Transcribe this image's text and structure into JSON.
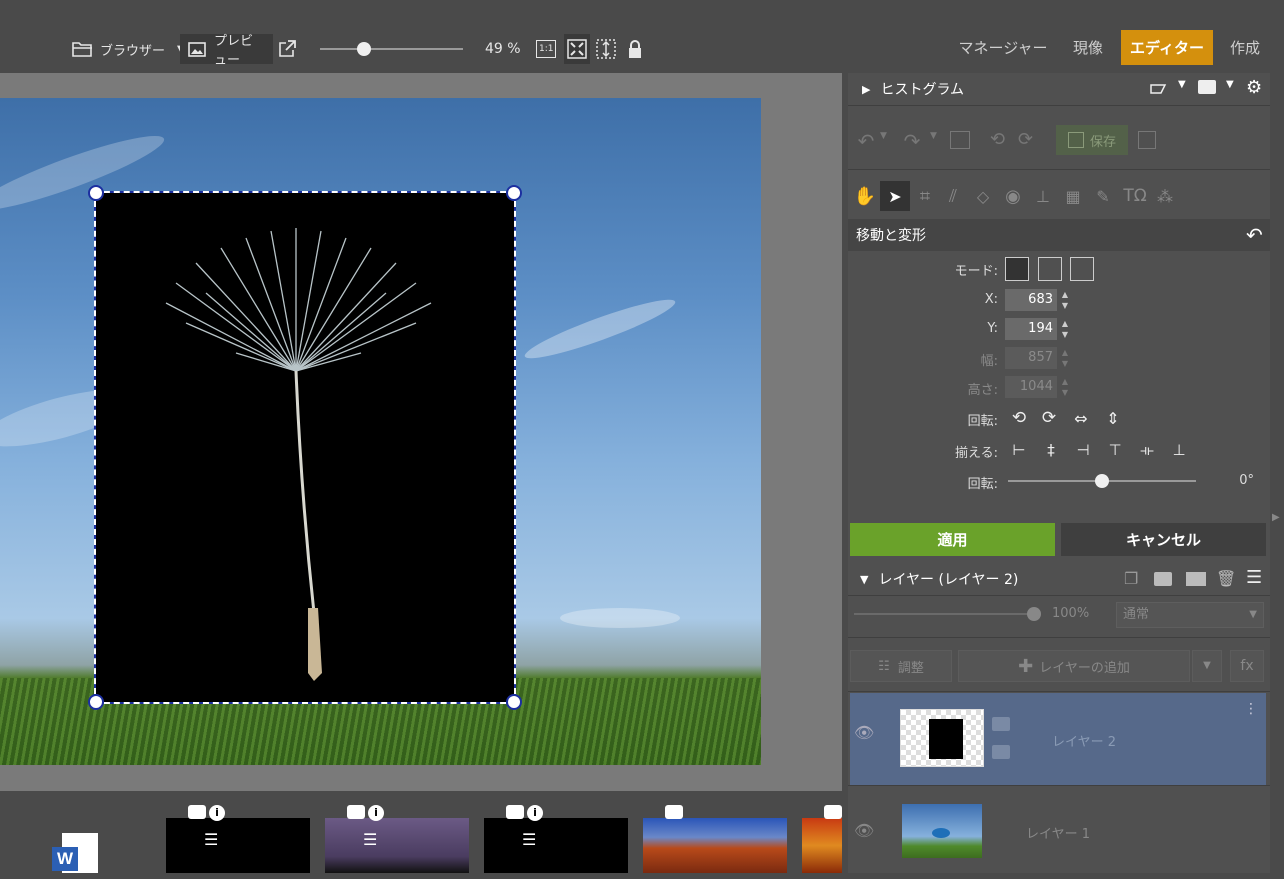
{
  "toolbar": {
    "browser_label": "ブラウザー",
    "preview_label": "プレビュー",
    "zoom_value": "49 %",
    "zoom_slider_fraction": 0.31,
    "one_to_one_label": "1:1"
  },
  "modes": {
    "manager": "マネージャー",
    "develop": "現像",
    "editor": "エディター",
    "create": "作成"
  },
  "colors": {
    "accent_orange": "#d4900d",
    "apply_green": "#6aa22a",
    "selected_layer": "#56698a",
    "selection_outline": "#1c2fa0"
  },
  "histogram": {
    "title": "ヒストグラム"
  },
  "history": {
    "save_label": "保存"
  },
  "transform": {
    "title": "移動と変形",
    "mode_label": "モード:",
    "x_label": "X:",
    "x_value": "683",
    "y_label": "Y:",
    "y_value": "194",
    "width_label": "幅:",
    "width_value": "857",
    "height_label": "高さ:",
    "height_value": "1044",
    "rotate_label": "回転:",
    "align_label": "揃える:",
    "rotation_label": "回転:",
    "rotation_value": "0°",
    "rotation_slider_fraction": 0.5
  },
  "actions": {
    "apply": "適用",
    "cancel": "キャンセル"
  },
  "layers": {
    "title": "レイヤー (レイヤー 2)",
    "opacity": "100%",
    "blend_mode": "通常",
    "adjust_label": "調整",
    "add_layer_label": "レイヤーの追加",
    "fx_label": "fx",
    "items": [
      {
        "name": "レイヤー 2",
        "selected": true
      },
      {
        "name": "レイヤー 1",
        "selected": false
      }
    ]
  },
  "icons": [
    "folder-icon",
    "image-icon",
    "external-link-icon",
    "fit-screen-icon",
    "lock-icon",
    "hand-icon",
    "pointer-icon",
    "crop-icon",
    "eye-icon",
    "undo-icon",
    "redo-icon",
    "camera-icon",
    "info-icon",
    "word-icon"
  ]
}
